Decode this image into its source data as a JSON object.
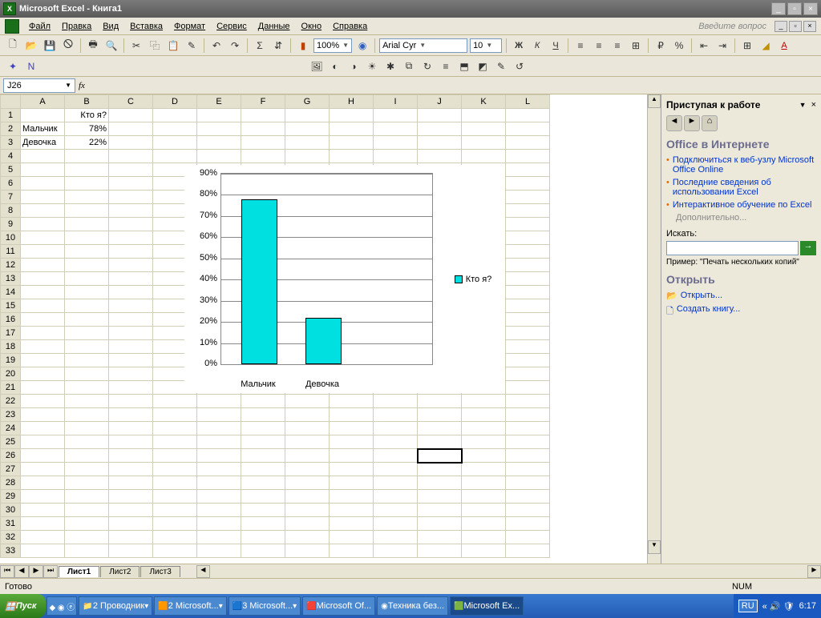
{
  "title": "Microsoft Excel - Книга1",
  "menu": [
    "Файл",
    "Правка",
    "Вид",
    "Вставка",
    "Формат",
    "Сервис",
    "Данные",
    "Окно",
    "Справка"
  ],
  "ask": "Введите вопрос",
  "zoom": "100%",
  "font": "Arial Cyr",
  "fontsize": "10",
  "namebox": "J26",
  "cols": [
    "A",
    "B",
    "C",
    "D",
    "E",
    "F",
    "G",
    "H",
    "I",
    "J",
    "K",
    "L"
  ],
  "data": {
    "B1": "Кто я?",
    "A2": "Мальчик",
    "B2": "78%",
    "A3": "Девочка",
    "B3": "22%"
  },
  "selected": "J26",
  "chart_data": {
    "type": "bar",
    "categories": [
      "Мальчик",
      "Девочка"
    ],
    "series": [
      {
        "name": "Кто я?",
        "values": [
          78,
          22
        ]
      }
    ],
    "ylim": [
      0,
      90
    ],
    "yticks": [
      "0%",
      "10%",
      "20%",
      "30%",
      "40%",
      "50%",
      "60%",
      "70%",
      "80%",
      "90%"
    ]
  },
  "sheets": [
    "Лист1",
    "Лист2",
    "Лист3"
  ],
  "taskpane": {
    "title": "Приступая к работе",
    "heading": "Office в Интернете",
    "links": [
      "Подключиться к веб-узлу Microsoft Office Online",
      "Последние сведения об использовании Excel",
      "Интерактивное обучение по Excel"
    ],
    "more": "Дополнительно...",
    "searchlabel": "Искать:",
    "example": "Пример: \"Печать нескольких копий\"",
    "open": "Открыть",
    "openlink": "Открыть...",
    "createlink": "Создать книгу..."
  },
  "status": {
    "ready": "Готово",
    "num": "NUM"
  },
  "taskbar": {
    "start": "Пуск",
    "items": [
      "2 Проводник",
      "2 Microsoft...",
      "3 Microsoft...",
      "Microsoft Of...",
      "Техника без...",
      "Microsoft Ex..."
    ],
    "lang": "RU",
    "time": "6:17"
  }
}
